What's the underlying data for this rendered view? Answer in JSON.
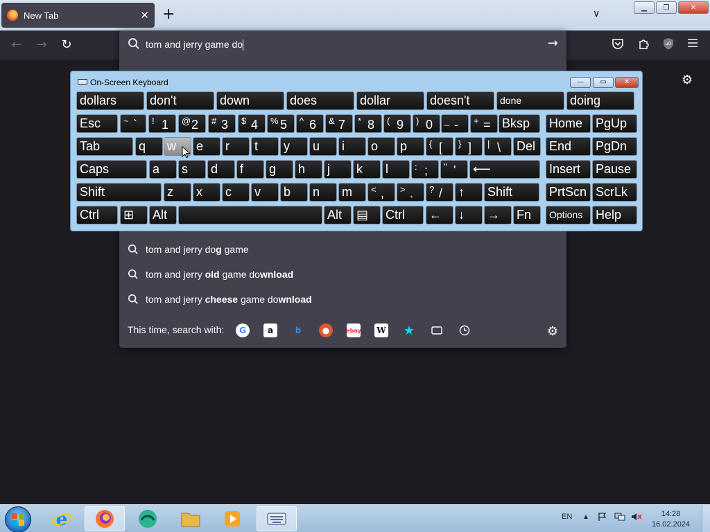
{
  "tab": {
    "title": "New Tab",
    "close": "✕"
  },
  "newtab": "+",
  "tablist": "∨",
  "window_controls": {
    "minimize": "▁",
    "restore": "❐",
    "close": "✕"
  },
  "nav": {
    "back": "←",
    "forward": "→",
    "reload": "↻"
  },
  "urlbar": {
    "value": "tom and jerry game do",
    "go": "→",
    "suggestions": [
      {
        "pre": "tom and jerry do",
        "bold": "g",
        "post": " game"
      },
      {
        "pre": "tom and jerry ",
        "bold": "old",
        "post": " game do",
        "bold2": "wnload"
      },
      {
        "pre": "tom and jerry ",
        "bold": "cheese",
        "post": " game do",
        "bold2": "wnload"
      }
    ],
    "search_with_label": "This time, search with:",
    "engines": [
      "google-icon",
      "amazon-icon",
      "bing-icon",
      "duckduckgo-icon",
      "ebay-icon",
      "wikipedia-icon",
      "bookmarks-icon",
      "tabs-icon",
      "history-icon"
    ]
  },
  "toolbar_icons": [
    "pocket-icon",
    "extensions-icon",
    "ublock-icon",
    "menu-icon"
  ],
  "osk": {
    "title": "On-Screen Keyboard",
    "controls": {
      "minimize": "—",
      "restore": "▭",
      "close": "✕"
    },
    "predictions": [
      "dollars",
      "don't",
      "down",
      "does",
      "dollar",
      "doesn't",
      "done",
      "doing"
    ],
    "row1": [
      "Esc",
      "~`",
      "!1",
      "@2",
      "#3",
      "$4",
      "%5",
      "^6",
      "&7",
      "*8",
      "(9",
      ")0",
      "_-",
      "+=",
      "Bksp",
      "Home",
      "PgUp"
    ],
    "row2": [
      "Tab",
      "q",
      "w",
      "e",
      "r",
      "t",
      "y",
      "u",
      "i",
      "o",
      "p",
      "{[",
      "}]",
      "|\\",
      "Del",
      "End",
      "PgDn"
    ],
    "row3": [
      "Caps",
      "a",
      "s",
      "d",
      "f",
      "g",
      "h",
      "j",
      "k",
      "l",
      ":;",
      "\"'",
      "⟵",
      "Insert",
      "Pause"
    ],
    "row4": [
      "Shift",
      "z",
      "x",
      "c",
      "v",
      "b",
      "n",
      "m",
      "<,",
      ">.",
      "?/",
      "↑",
      "Shift",
      "PrtScn",
      "ScrLk"
    ],
    "row5": [
      "Ctrl",
      "⊞",
      "Alt",
      "",
      "Alt",
      "▤",
      "Ctrl",
      "←",
      "↓",
      "→",
      "Fn",
      "Options",
      "Help"
    ],
    "pressed_key": "w"
  },
  "taskbar": {
    "language": "EN",
    "time": "14:28",
    "date": "16.02.2024"
  }
}
